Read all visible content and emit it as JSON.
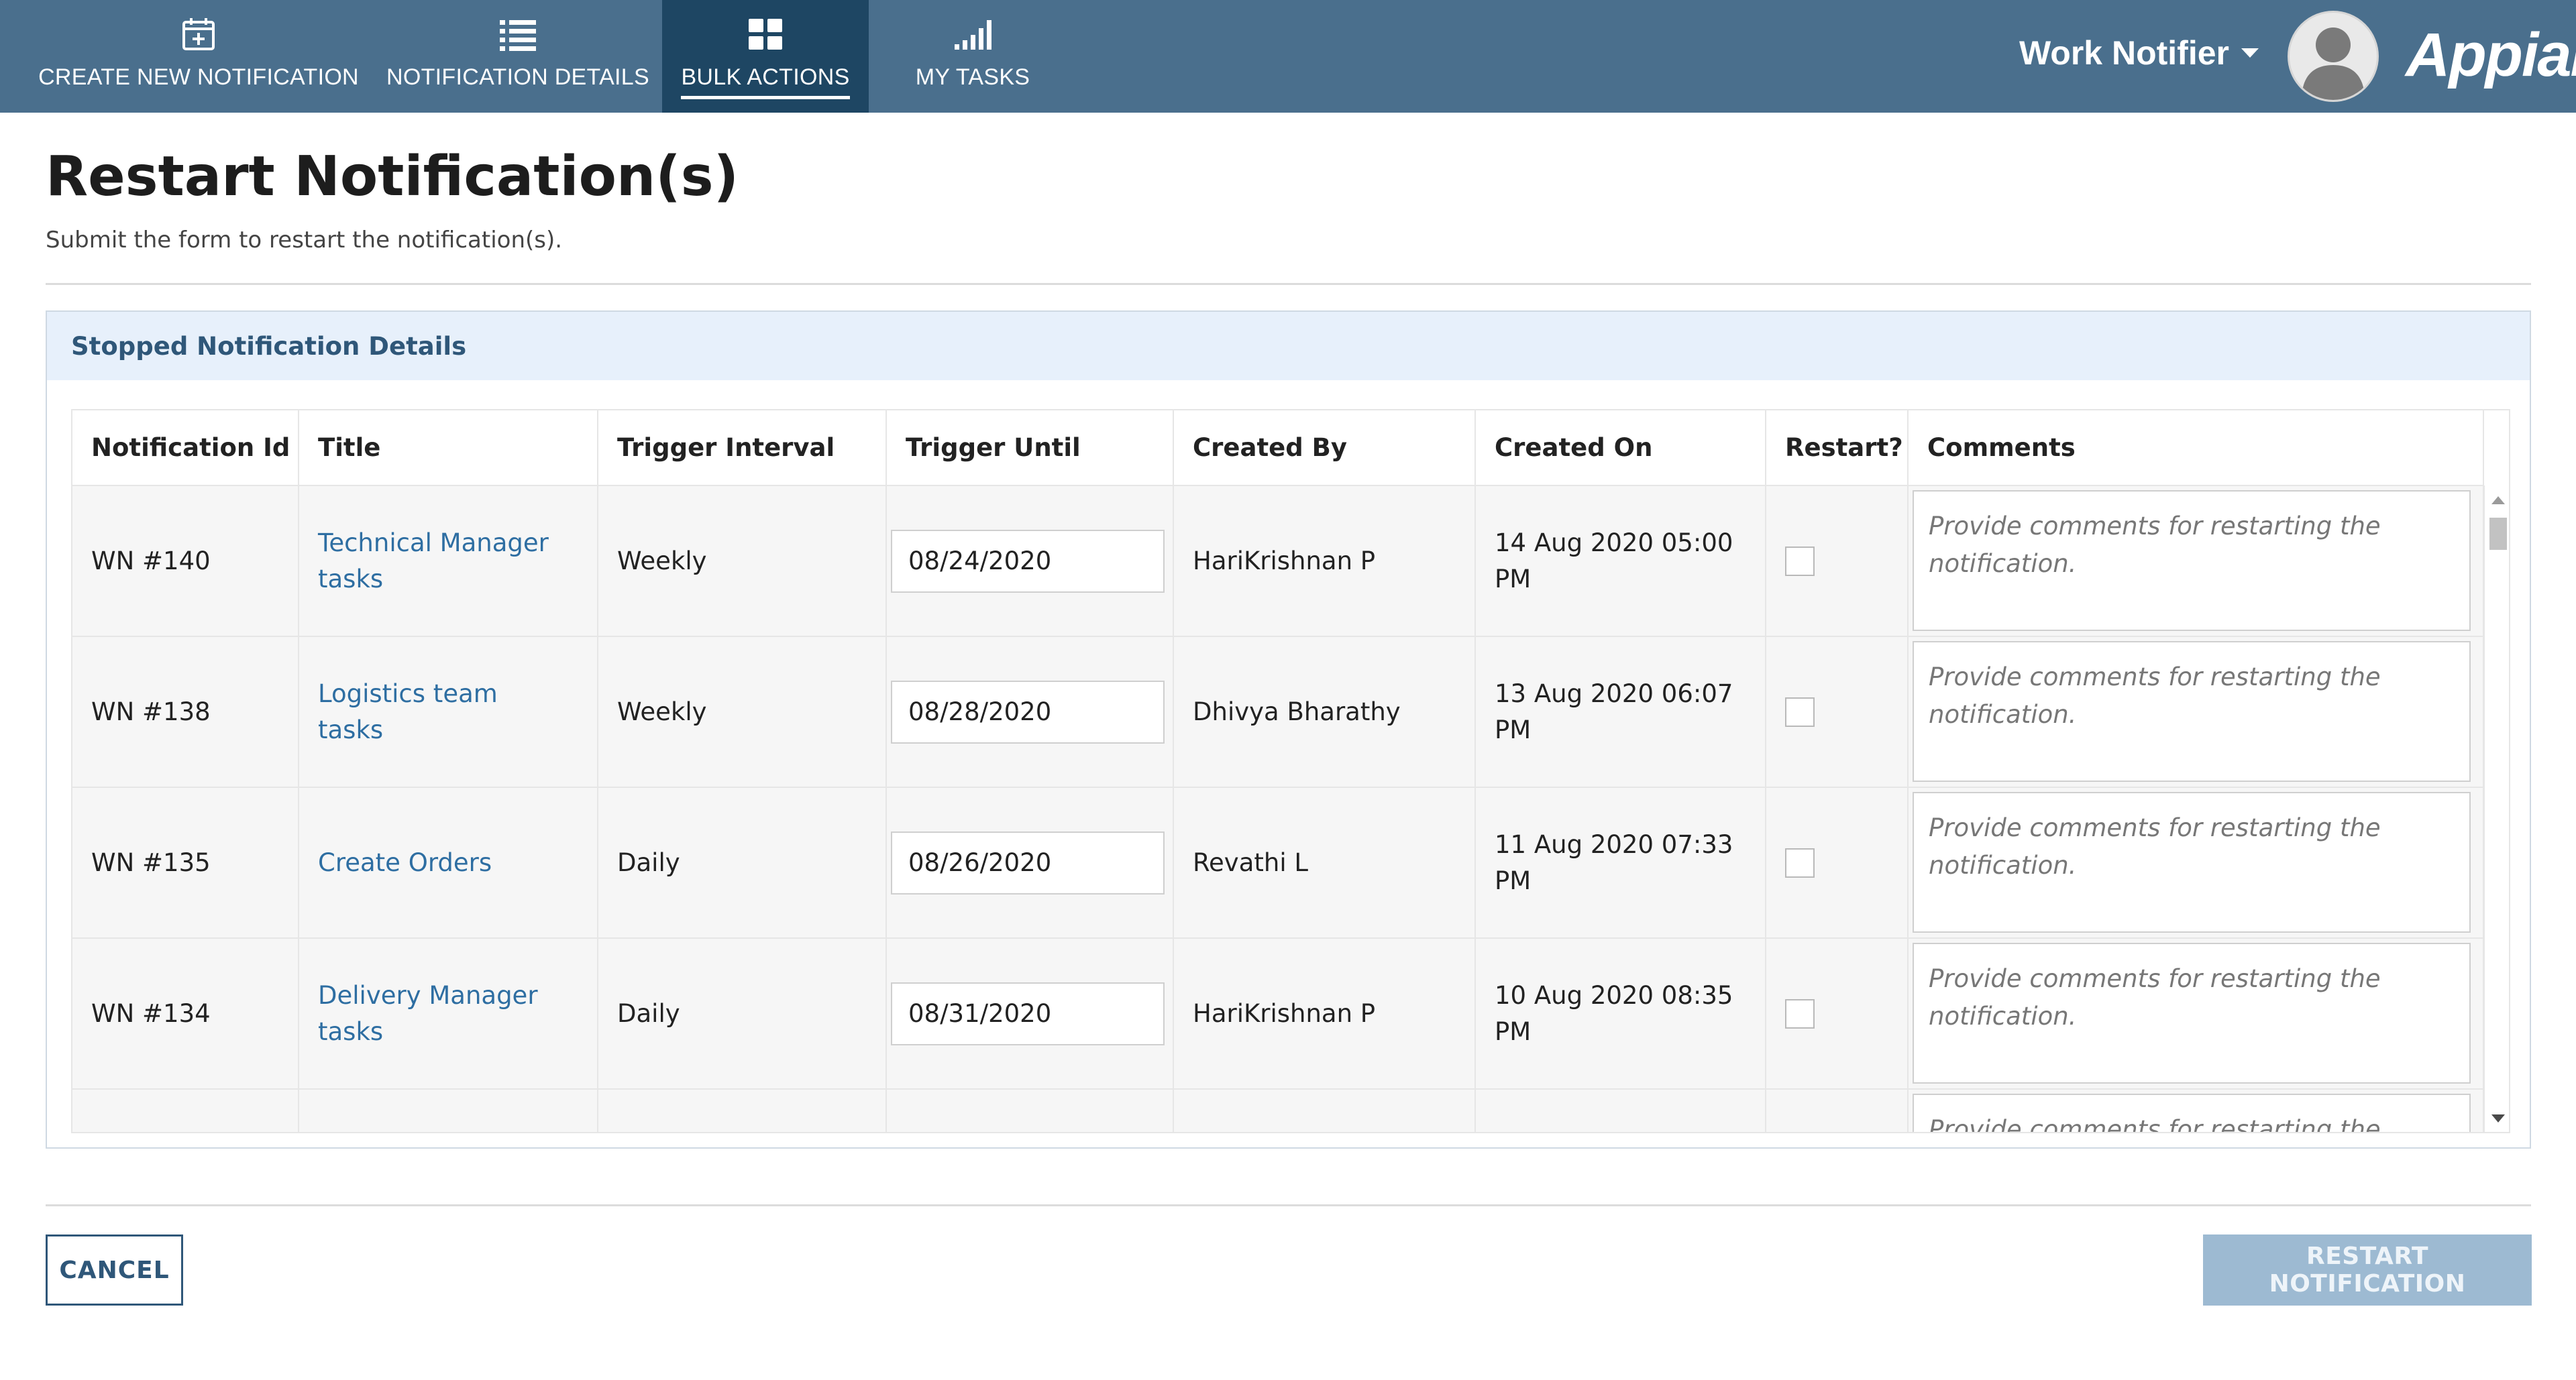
{
  "nav": {
    "items": [
      {
        "label": "CREATE NEW NOTIFICATION",
        "icon": "calendar-plus-icon"
      },
      {
        "label": "NOTIFICATION DETAILS",
        "icon": "list-icon"
      },
      {
        "label": "BULK ACTIONS",
        "icon": "grid-icon",
        "active": true
      },
      {
        "label": "MY TASKS",
        "icon": "signal-bars-icon"
      }
    ]
  },
  "header": {
    "app_name": "Work Notifier",
    "brand": "Appian"
  },
  "page": {
    "title": "Restart Notification(s)",
    "subtitle": "Submit the form to restart the notification(s)."
  },
  "section": {
    "title": "Stopped Notification Details"
  },
  "table": {
    "columns": [
      "Notification Id",
      "Title",
      "Trigger Interval",
      "Trigger Until",
      "Created By",
      "Created On",
      "Restart?",
      "Comments"
    ],
    "comment_placeholder": "Provide comments for restarting the notification.",
    "rows": [
      {
        "id": "WN #140",
        "title": "Technical Manager tasks",
        "interval": "Weekly",
        "until": "08/24/2020",
        "created_by": "HariKrishnan P",
        "created_on": "14 Aug 2020 05:00 PM"
      },
      {
        "id": "WN #138",
        "title": "Logistics team tasks",
        "interval": "Weekly",
        "until": "08/28/2020",
        "created_by": "Dhivya Bharathy",
        "created_on": "13 Aug 2020 06:07 PM"
      },
      {
        "id": "WN #135",
        "title": "Create Orders",
        "interval": "Daily",
        "until": "08/26/2020",
        "created_by": "Revathi L",
        "created_on": "11 Aug 2020 07:33 PM"
      },
      {
        "id": "WN #134",
        "title": "Delivery Manager tasks",
        "interval": "Daily",
        "until": "08/31/2020",
        "created_by": "HariKrishnan P",
        "created_on": "10 Aug 2020 08:35 PM"
      }
    ]
  },
  "buttons": {
    "cancel": "CANCEL",
    "restart": "RESTART NOTIFICATION"
  },
  "colors": {
    "topbar": "#4a6f8d",
    "nav_active": "#1e4663",
    "accent": "#2f5779",
    "link": "#2e6ea2",
    "section_header_bg": "#e7f0fb",
    "disabled_button": "#9dbad2"
  }
}
